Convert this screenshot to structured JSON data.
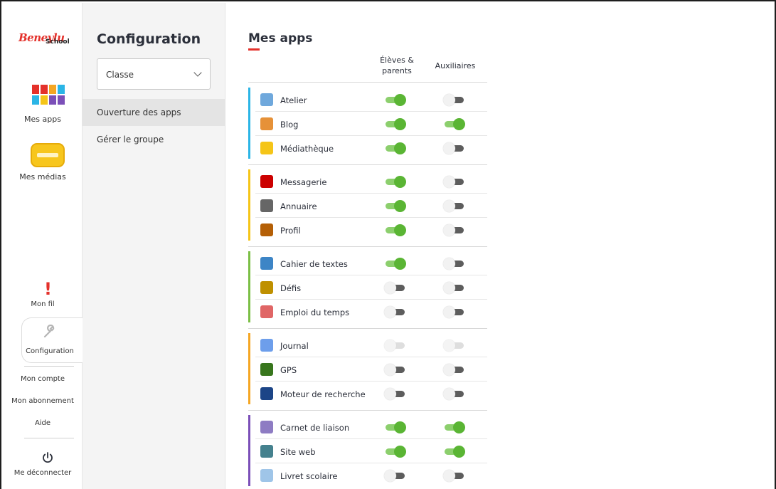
{
  "rail": {
    "logo_text_1": "Beneylu",
    "logo_text_2": "School",
    "mes_apps": "Mes apps",
    "mes_medias": "Mes médias",
    "mon_fil": "Mon fil",
    "configuration": "Configuration",
    "mon_compte": "Mon compte",
    "mon_abonnement": "Mon abonnement",
    "aide": "Aide",
    "deconnecter": "Me déconnecter"
  },
  "config": {
    "title": "Configuration",
    "select_value": "Classe",
    "items": [
      "Ouverture des apps",
      "Gérer le groupe"
    ]
  },
  "main": {
    "title": "Mes apps",
    "col_eleves_1": "Élèves &",
    "col_eleves_2": "parents",
    "col_auxiliaires": "Auxiliaires"
  },
  "colors": {
    "accent": "#e4312b",
    "toggle_on": "#5ab534",
    "group_1": "#2bb5e6",
    "group_2": "#f5c518",
    "group_3": "#7bbf45",
    "group_4": "#f5a623",
    "group_5": "#7b4fb8"
  },
  "groups": [
    {
      "apps": [
        {
          "name": "Atelier",
          "icon": "atelier-icon",
          "eleves": "on",
          "aux": "off"
        },
        {
          "name": "Blog",
          "icon": "blog-icon",
          "eleves": "on",
          "aux": "on"
        },
        {
          "name": "Médiathèque",
          "icon": "mediatheque-icon",
          "eleves": "on",
          "aux": "off"
        }
      ]
    },
    {
      "apps": [
        {
          "name": "Messagerie",
          "icon": "messagerie-icon",
          "eleves": "on",
          "aux": "off"
        },
        {
          "name": "Annuaire",
          "icon": "annuaire-icon",
          "eleves": "on",
          "aux": "off"
        },
        {
          "name": "Profil",
          "icon": "profil-icon",
          "eleves": "on",
          "aux": "off"
        }
      ]
    },
    {
      "apps": [
        {
          "name": "Cahier de textes",
          "icon": "cahier-icon",
          "eleves": "on",
          "aux": "off"
        },
        {
          "name": "Défis",
          "icon": "defis-icon",
          "eleves": "off",
          "aux": "off"
        },
        {
          "name": "Emploi du temps",
          "icon": "emploi-icon",
          "eleves": "off",
          "aux": "off"
        }
      ]
    },
    {
      "apps": [
        {
          "name": "Journal",
          "icon": "journal-icon",
          "eleves": "disabled",
          "aux": "disabled"
        },
        {
          "name": "GPS",
          "icon": "gps-icon",
          "eleves": "off",
          "aux": "off"
        },
        {
          "name": "Moteur de recherche",
          "icon": "search-icon",
          "eleves": "off",
          "aux": "off"
        }
      ]
    },
    {
      "apps": [
        {
          "name": "Carnet de liaison",
          "icon": "carnet-icon",
          "eleves": "on",
          "aux": "on"
        },
        {
          "name": "Site web",
          "icon": "siteweb-icon",
          "eleves": "on",
          "aux": "on"
        },
        {
          "name": "Livret scolaire",
          "icon": "livret-icon",
          "eleves": "off",
          "aux": "off"
        }
      ]
    }
  ]
}
